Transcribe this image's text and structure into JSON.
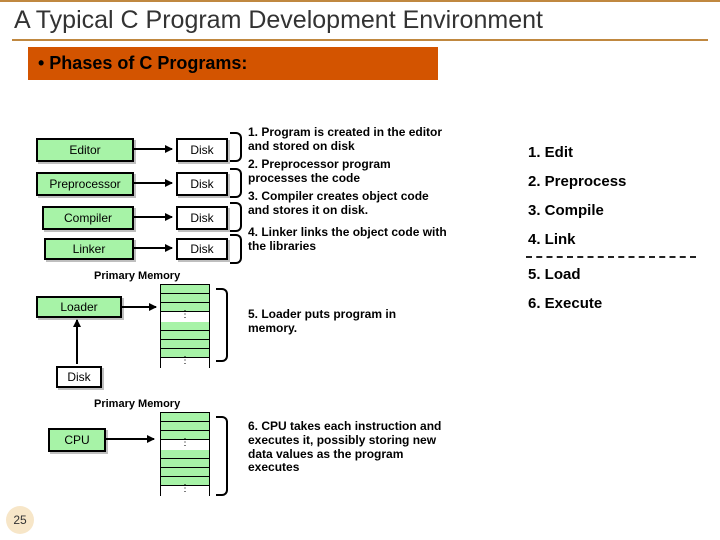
{
  "title": "A Typical C Program Development Environment",
  "phases_bar": "• Phases of C Programs:",
  "stages": {
    "editor": "Editor",
    "preprocessor": "Preprocessor",
    "compiler": "Compiler",
    "linker": "Linker",
    "loader": "Loader",
    "cpu": "CPU"
  },
  "disk": "Disk",
  "memory_label": "Primary Memory",
  "descriptions": {
    "d1": "1. Program is created in the editor and stored on disk",
    "d2": "2. Preprocessor program processes the code",
    "d3": "3. Compiler creates object code and stores it on disk.",
    "d4": "4. Linker links the object code with the libraries",
    "d5": "5. Loader puts program in memory.",
    "d6": "6. CPU takes each instruction and executes it, possibly storing new data values as the program executes"
  },
  "phases": {
    "p1": "1. Edit",
    "p2": "2. Preprocess",
    "p3": "3. Compile",
    "p4": "4. Link",
    "p5": "5. Load",
    "p6": "6. Execute"
  },
  "page_number": "25"
}
